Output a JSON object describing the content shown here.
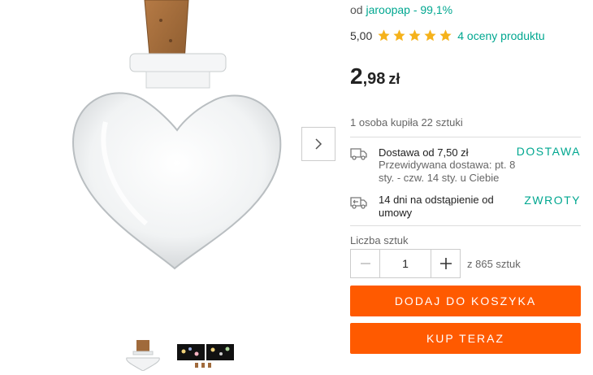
{
  "seller": {
    "prefix": "od",
    "name": "jaroopap - 99,1%"
  },
  "rating": {
    "score": "5,00",
    "stars": 5,
    "reviews_label": "4 oceny produktu"
  },
  "price": {
    "int": "2",
    "dec": ",98",
    "currency": "zł"
  },
  "bought_text": "1 osoba kupiła 22 sztuki",
  "delivery": {
    "title": "Dostawa od 7,50 zł",
    "estimate": "Przewidywana dostawa: pt. 8 sty. - czw. 14 sty. u Ciebie",
    "link": "DOSTAWA"
  },
  "returns": {
    "title": "14 dni na odstąpienie od umowy",
    "link": "ZWROTY"
  },
  "quantity": {
    "label": "Liczba sztuk",
    "value": "1",
    "available": "z 865 sztuk"
  },
  "buttons": {
    "add_to_cart": "DODAJ DO KOSZYKA",
    "buy_now": "KUP TERAZ"
  },
  "colors": {
    "accent": "#00a790",
    "primary_button": "#ff5a00",
    "star": "#f5b21b"
  },
  "icons": [
    "chevron-right-icon",
    "truck-icon",
    "return-truck-icon",
    "minus-icon",
    "plus-icon",
    "star-icon"
  ]
}
